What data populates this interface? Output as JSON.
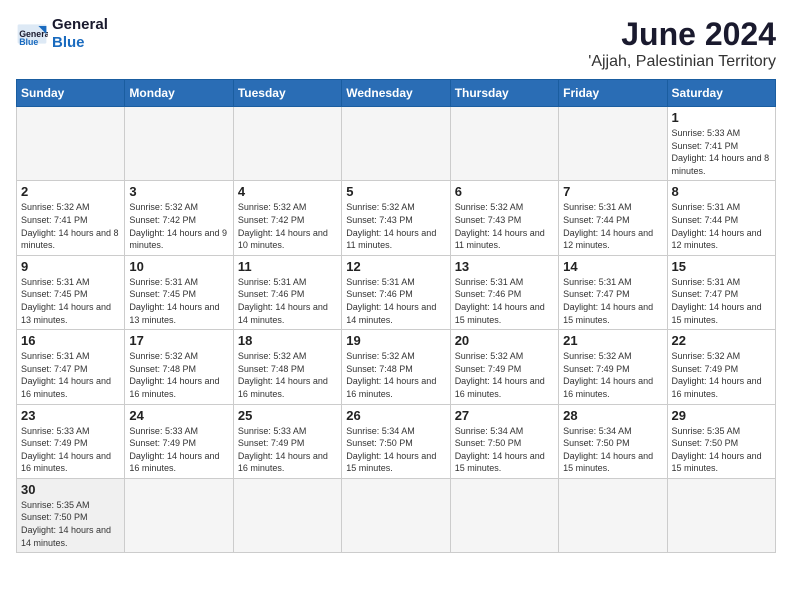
{
  "header": {
    "logo_general": "General",
    "logo_blue": "Blue",
    "month_title": "June 2024",
    "location": "'Ajjah, Palestinian Territory"
  },
  "weekdays": [
    "Sunday",
    "Monday",
    "Tuesday",
    "Wednesday",
    "Thursday",
    "Friday",
    "Saturday"
  ],
  "weeks": [
    [
      {
        "day": "",
        "sunrise": "",
        "sunset": "",
        "daylight": ""
      },
      {
        "day": "",
        "sunrise": "",
        "sunset": "",
        "daylight": ""
      },
      {
        "day": "",
        "sunrise": "",
        "sunset": "",
        "daylight": ""
      },
      {
        "day": "",
        "sunrise": "",
        "sunset": "",
        "daylight": ""
      },
      {
        "day": "",
        "sunrise": "",
        "sunset": "",
        "daylight": ""
      },
      {
        "day": "",
        "sunrise": "",
        "sunset": "",
        "daylight": ""
      },
      {
        "day": "1",
        "sunrise": "Sunrise: 5:33 AM",
        "sunset": "Sunset: 7:41 PM",
        "daylight": "Daylight: 14 hours and 8 minutes."
      }
    ],
    [
      {
        "day": "2",
        "sunrise": "Sunrise: 5:32 AM",
        "sunset": "Sunset: 7:41 PM",
        "daylight": "Daylight: 14 hours and 8 minutes."
      },
      {
        "day": "3",
        "sunrise": "Sunrise: 5:32 AM",
        "sunset": "Sunset: 7:42 PM",
        "daylight": "Daylight: 14 hours and 9 minutes."
      },
      {
        "day": "4",
        "sunrise": "Sunrise: 5:32 AM",
        "sunset": "Sunset: 7:42 PM",
        "daylight": "Daylight: 14 hours and 10 minutes."
      },
      {
        "day": "5",
        "sunrise": "Sunrise: 5:32 AM",
        "sunset": "Sunset: 7:43 PM",
        "daylight": "Daylight: 14 hours and 11 minutes."
      },
      {
        "day": "6",
        "sunrise": "Sunrise: 5:32 AM",
        "sunset": "Sunset: 7:43 PM",
        "daylight": "Daylight: 14 hours and 11 minutes."
      },
      {
        "day": "7",
        "sunrise": "Sunrise: 5:31 AM",
        "sunset": "Sunset: 7:44 PM",
        "daylight": "Daylight: 14 hours and 12 minutes."
      },
      {
        "day": "8",
        "sunrise": "Sunrise: 5:31 AM",
        "sunset": "Sunset: 7:44 PM",
        "daylight": "Daylight: 14 hours and 12 minutes."
      }
    ],
    [
      {
        "day": "9",
        "sunrise": "Sunrise: 5:31 AM",
        "sunset": "Sunset: 7:45 PM",
        "daylight": "Daylight: 14 hours and 13 minutes."
      },
      {
        "day": "10",
        "sunrise": "Sunrise: 5:31 AM",
        "sunset": "Sunset: 7:45 PM",
        "daylight": "Daylight: 14 hours and 13 minutes."
      },
      {
        "day": "11",
        "sunrise": "Sunrise: 5:31 AM",
        "sunset": "Sunset: 7:46 PM",
        "daylight": "Daylight: 14 hours and 14 minutes."
      },
      {
        "day": "12",
        "sunrise": "Sunrise: 5:31 AM",
        "sunset": "Sunset: 7:46 PM",
        "daylight": "Daylight: 14 hours and 14 minutes."
      },
      {
        "day": "13",
        "sunrise": "Sunrise: 5:31 AM",
        "sunset": "Sunset: 7:46 PM",
        "daylight": "Daylight: 14 hours and 15 minutes."
      },
      {
        "day": "14",
        "sunrise": "Sunrise: 5:31 AM",
        "sunset": "Sunset: 7:47 PM",
        "daylight": "Daylight: 14 hours and 15 minutes."
      },
      {
        "day": "15",
        "sunrise": "Sunrise: 5:31 AM",
        "sunset": "Sunset: 7:47 PM",
        "daylight": "Daylight: 14 hours and 15 minutes."
      }
    ],
    [
      {
        "day": "16",
        "sunrise": "Sunrise: 5:31 AM",
        "sunset": "Sunset: 7:47 PM",
        "daylight": "Daylight: 14 hours and 16 minutes."
      },
      {
        "day": "17",
        "sunrise": "Sunrise: 5:32 AM",
        "sunset": "Sunset: 7:48 PM",
        "daylight": "Daylight: 14 hours and 16 minutes."
      },
      {
        "day": "18",
        "sunrise": "Sunrise: 5:32 AM",
        "sunset": "Sunset: 7:48 PM",
        "daylight": "Daylight: 14 hours and 16 minutes."
      },
      {
        "day": "19",
        "sunrise": "Sunrise: 5:32 AM",
        "sunset": "Sunset: 7:48 PM",
        "daylight": "Daylight: 14 hours and 16 minutes."
      },
      {
        "day": "20",
        "sunrise": "Sunrise: 5:32 AM",
        "sunset": "Sunset: 7:49 PM",
        "daylight": "Daylight: 14 hours and 16 minutes."
      },
      {
        "day": "21",
        "sunrise": "Sunrise: 5:32 AM",
        "sunset": "Sunset: 7:49 PM",
        "daylight": "Daylight: 14 hours and 16 minutes."
      },
      {
        "day": "22",
        "sunrise": "Sunrise: 5:32 AM",
        "sunset": "Sunset: 7:49 PM",
        "daylight": "Daylight: 14 hours and 16 minutes."
      }
    ],
    [
      {
        "day": "23",
        "sunrise": "Sunrise: 5:33 AM",
        "sunset": "Sunset: 7:49 PM",
        "daylight": "Daylight: 14 hours and 16 minutes."
      },
      {
        "day": "24",
        "sunrise": "Sunrise: 5:33 AM",
        "sunset": "Sunset: 7:49 PM",
        "daylight": "Daylight: 14 hours and 16 minutes."
      },
      {
        "day": "25",
        "sunrise": "Sunrise: 5:33 AM",
        "sunset": "Sunset: 7:49 PM",
        "daylight": "Daylight: 14 hours and 16 minutes."
      },
      {
        "day": "26",
        "sunrise": "Sunrise: 5:34 AM",
        "sunset": "Sunset: 7:50 PM",
        "daylight": "Daylight: 14 hours and 15 minutes."
      },
      {
        "day": "27",
        "sunrise": "Sunrise: 5:34 AM",
        "sunset": "Sunset: 7:50 PM",
        "daylight": "Daylight: 14 hours and 15 minutes."
      },
      {
        "day": "28",
        "sunrise": "Sunrise: 5:34 AM",
        "sunset": "Sunset: 7:50 PM",
        "daylight": "Daylight: 14 hours and 15 minutes."
      },
      {
        "day": "29",
        "sunrise": "Sunrise: 5:35 AM",
        "sunset": "Sunset: 7:50 PM",
        "daylight": "Daylight: 14 hours and 15 minutes."
      }
    ],
    [
      {
        "day": "30",
        "sunrise": "Sunrise: 5:35 AM",
        "sunset": "Sunset: 7:50 PM",
        "daylight": "Daylight: 14 hours and 14 minutes."
      },
      {
        "day": "",
        "sunrise": "",
        "sunset": "",
        "daylight": ""
      },
      {
        "day": "",
        "sunrise": "",
        "sunset": "",
        "daylight": ""
      },
      {
        "day": "",
        "sunrise": "",
        "sunset": "",
        "daylight": ""
      },
      {
        "day": "",
        "sunrise": "",
        "sunset": "",
        "daylight": ""
      },
      {
        "day": "",
        "sunrise": "",
        "sunset": "",
        "daylight": ""
      },
      {
        "day": "",
        "sunrise": "",
        "sunset": "",
        "daylight": ""
      }
    ]
  ]
}
